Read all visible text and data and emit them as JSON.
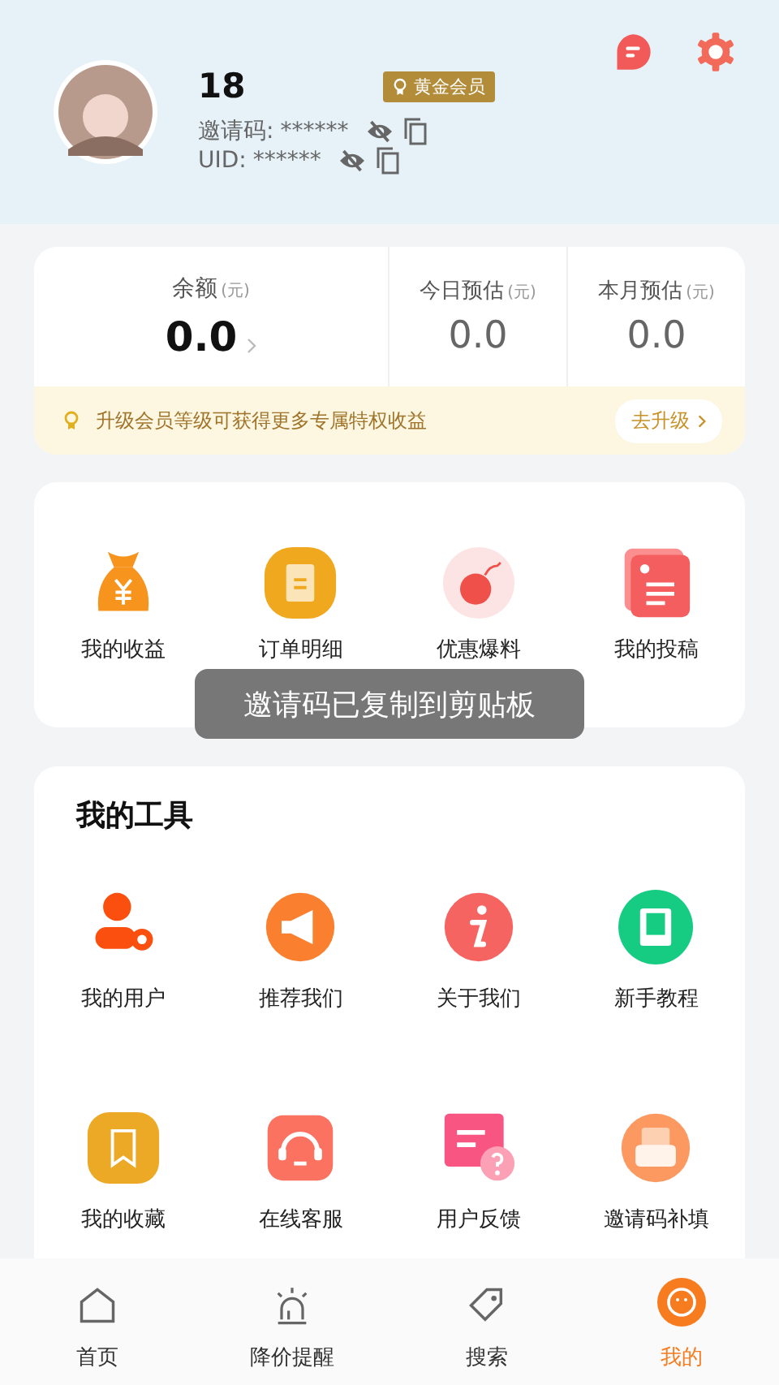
{
  "profile": {
    "name": "18",
    "badge": "黄金会员",
    "invite_label": "邀请码:",
    "invite_value": "******",
    "uid_label": "UID:",
    "uid_value": "******"
  },
  "balance": {
    "items": [
      {
        "kind": "main",
        "label": "余额",
        "unit": "(元)",
        "value": "0.0"
      },
      {
        "kind": "sub",
        "label": "今日预估",
        "unit": "(元)",
        "value": "0.0"
      },
      {
        "kind": "sub",
        "label": "本月预估",
        "unit": "(元)",
        "value": "0.0"
      }
    ],
    "banner": "升级会员等级可获得更多专属特权收益",
    "upgrade_button": "去升级"
  },
  "shortcuts": [
    {
      "kind": "bag",
      "label": "我的收益"
    },
    {
      "kind": "clipboard",
      "label": "订单明细"
    },
    {
      "kind": "bomb",
      "label": "优惠爆料"
    },
    {
      "kind": "doc",
      "label": "我的投稿"
    }
  ],
  "toast": "邀请码已复制到剪贴板",
  "tools": {
    "title": "我的工具",
    "items": [
      {
        "kind": "user",
        "label": "我的用户"
      },
      {
        "kind": "megaphone",
        "label": "推荐我们"
      },
      {
        "kind": "info",
        "label": "关于我们"
      },
      {
        "kind": "book",
        "label": "新手教程"
      },
      {
        "kind": "bookmark",
        "label": "我的收藏"
      },
      {
        "kind": "headset",
        "label": "在线客服"
      },
      {
        "kind": "feedback",
        "label": "用户反馈"
      },
      {
        "kind": "envelope",
        "label": "邀请码补填"
      }
    ]
  },
  "tabs": [
    {
      "kind": "home",
      "label": "首页",
      "selected": false
    },
    {
      "kind": "alarm",
      "label": "降价提醒",
      "selected": false
    },
    {
      "kind": "tag",
      "label": "搜索",
      "selected": false
    },
    {
      "kind": "face",
      "label": "我的",
      "selected": true
    }
  ]
}
